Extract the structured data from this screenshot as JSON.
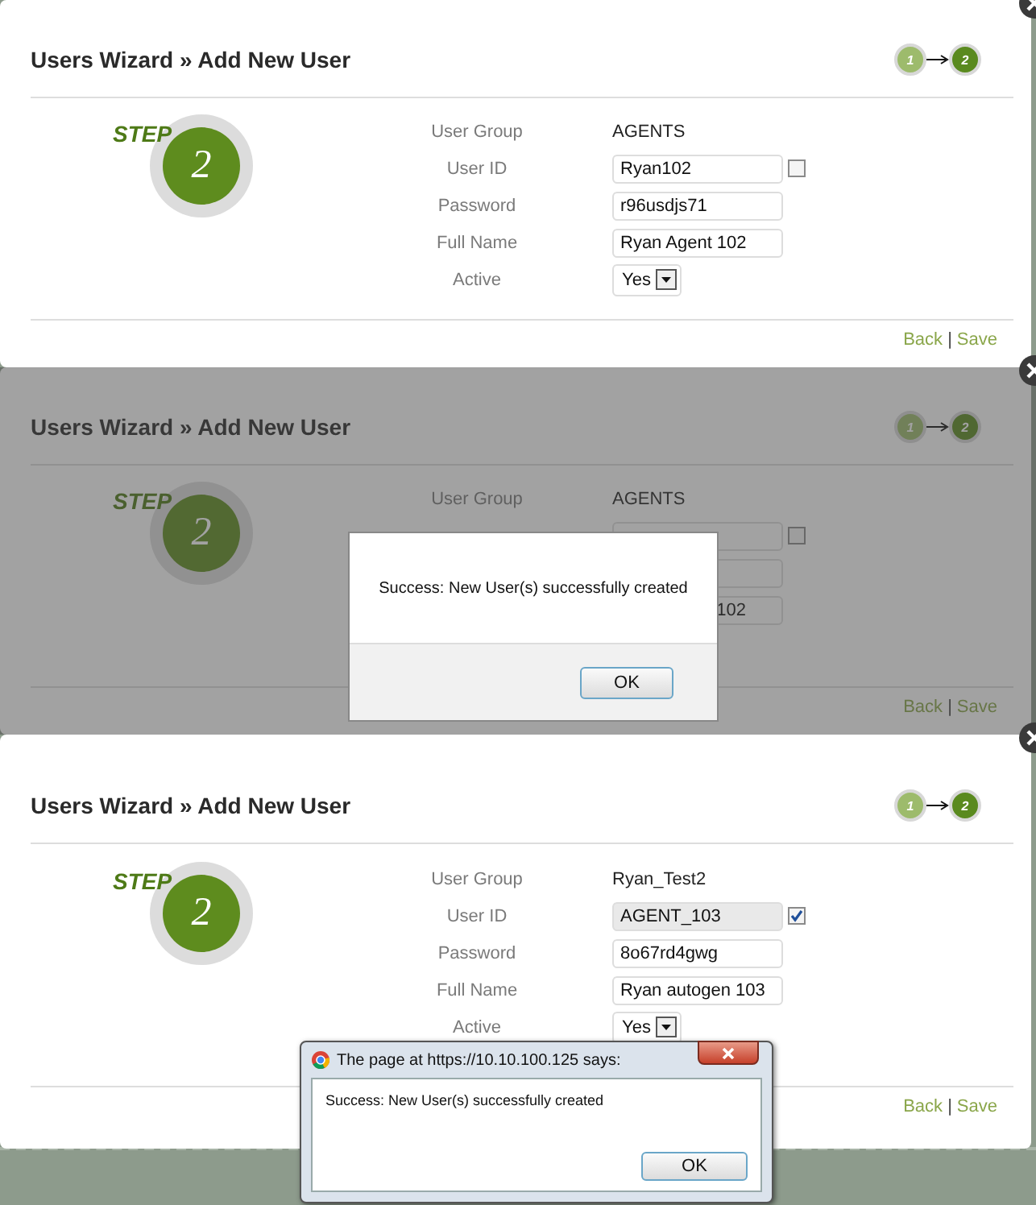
{
  "panels": [
    {
      "title": "Users Wizard » Add New User",
      "dimmed": false,
      "steps": [
        {
          "label": "1",
          "selected": false
        },
        {
          "label": "2",
          "selected": true
        }
      ],
      "step_badge": {
        "word": "STEP",
        "number": "2"
      },
      "fields": [
        {
          "kind": "text",
          "label": "User Group",
          "value": "AGENTS"
        },
        {
          "kind": "input",
          "label": "User ID",
          "value": "Ryan102",
          "disabled": false,
          "checkbox": {
            "checked": false
          }
        },
        {
          "kind": "input",
          "label": "Password",
          "value": "r96usdjs71",
          "disabled": false
        },
        {
          "kind": "input",
          "label": "Full Name",
          "value": "Ryan Agent 102",
          "disabled": false
        },
        {
          "kind": "select",
          "label": "Active",
          "value": "Yes"
        }
      ],
      "links": {
        "back": "Back",
        "separator": "|",
        "save": "Save"
      }
    },
    {
      "title": "Users Wizard » Add New User",
      "dimmed": true,
      "steps": [
        {
          "label": "1",
          "selected": false
        },
        {
          "label": "2",
          "selected": true
        }
      ],
      "step_badge": {
        "word": "STEP",
        "number": "2"
      },
      "fields": [
        {
          "kind": "text",
          "label": "User Group",
          "value": "AGENTS"
        },
        {
          "kind": "input",
          "checkbox": {
            "checked": false
          }
        },
        {
          "kind": "input"
        },
        {
          "kind": "input",
          "value": "102"
        }
      ],
      "links": {
        "back": "Back",
        "separator": "|",
        "save": "Save"
      },
      "dialog": {
        "kind": "modal",
        "message": "Success: New User(s) successfully created",
        "button": "OK"
      }
    },
    {
      "title": "Users Wizard » Add New User",
      "dimmed": false,
      "steps": [
        {
          "label": "1",
          "selected": false
        },
        {
          "label": "2",
          "selected": true
        }
      ],
      "step_badge": {
        "word": "STEP",
        "number": "2"
      },
      "fields": [
        {
          "kind": "text",
          "label": "User Group",
          "value": "Ryan_Test2"
        },
        {
          "kind": "input",
          "label": "User ID",
          "value": "AGENT_103",
          "disabled": true,
          "checkbox": {
            "checked": true
          }
        },
        {
          "kind": "input",
          "label": "Password",
          "value": "8o67rd4gwg",
          "disabled": false
        },
        {
          "kind": "input",
          "label": "Full Name",
          "value": "Ryan autogen 103",
          "disabled": false
        },
        {
          "kind": "select",
          "label": "Active",
          "value": "Yes"
        }
      ],
      "links": {
        "back": "Back",
        "separator": "|",
        "save": "Save"
      },
      "dialog": {
        "kind": "browser",
        "title": "The page at https://10.10.100.125 says:",
        "message": "Success: New User(s) successfully created",
        "button": "OK"
      }
    }
  ]
}
